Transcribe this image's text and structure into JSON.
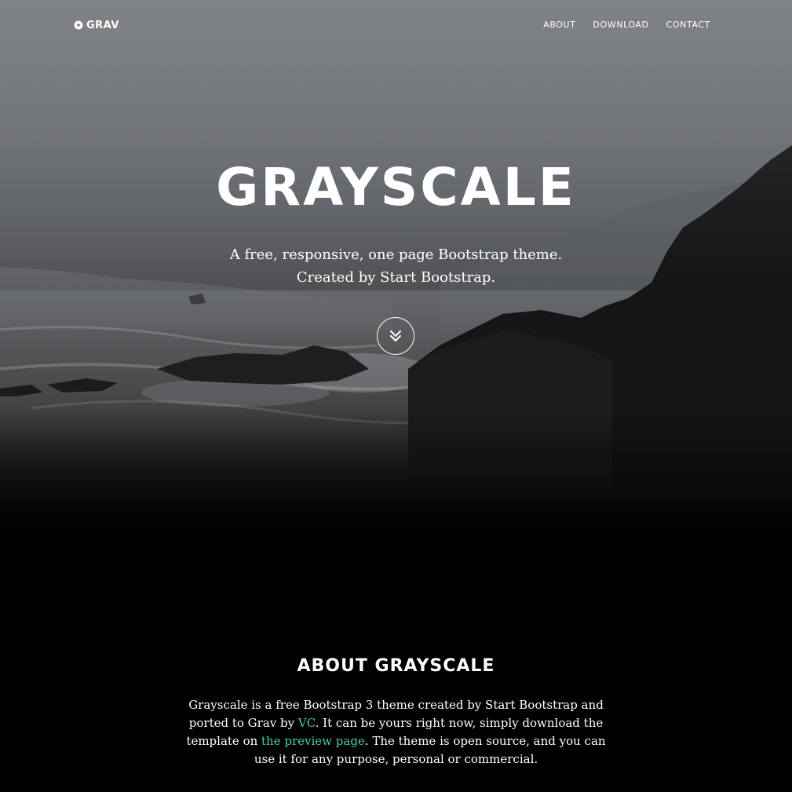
{
  "nav": {
    "brand": "GRAV",
    "links": [
      "ABOUT",
      "DOWNLOAD",
      "CONTACT"
    ]
  },
  "hero": {
    "title": "GRAYSCALE",
    "subtitle_line1": "A free, responsive, one page Bootstrap theme.",
    "subtitle_line2": "Created by Start Bootstrap.",
    "scroll_icon": "double-chevron-down-icon"
  },
  "about": {
    "title": "ABOUT GRAYSCALE",
    "text_1": "Grayscale is a free Bootstrap 3 theme created by Start Bootstrap and ported to Grav by ",
    "link_vc": "VC",
    "text_2": ". It can be yours right now, simply download the template on ",
    "link_preview": "the preview page",
    "text_3": ". The theme is open source, and you can use it for any purpose, personal or commercial."
  },
  "colors": {
    "link": "#3ed39d",
    "background": "#000000",
    "text": "#ffffff"
  }
}
